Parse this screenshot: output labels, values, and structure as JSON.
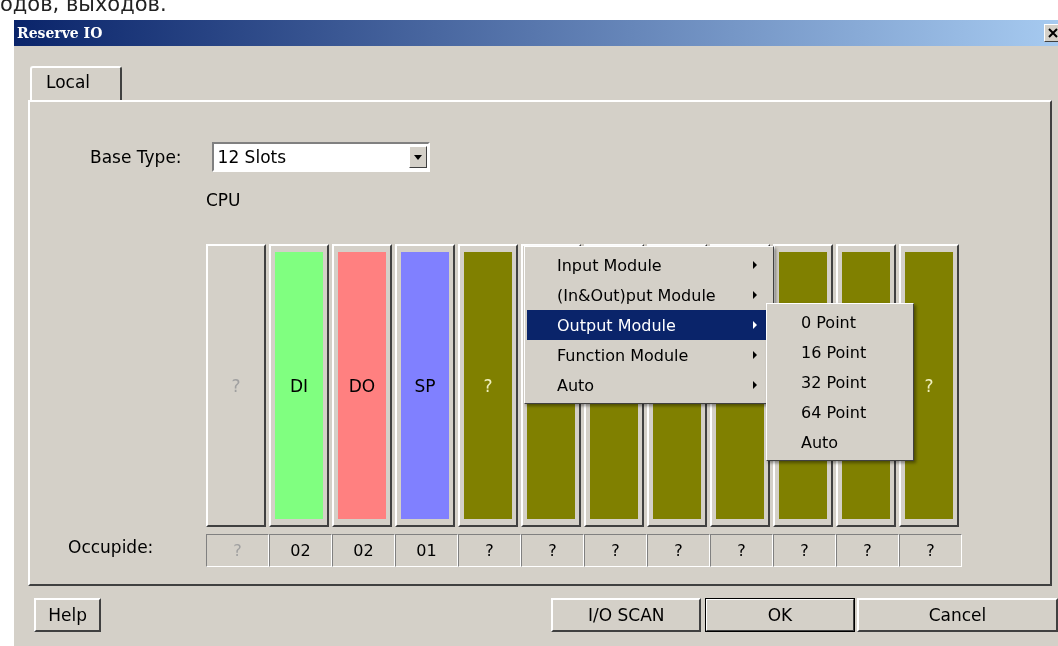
{
  "caption": "одов, выходов.",
  "window": {
    "title": "Reserve IO"
  },
  "tabs": [
    {
      "label": "Local",
      "selected": true
    }
  ],
  "base_type": {
    "label": "Base Type:",
    "value": "12 Slots"
  },
  "cpu_label": "CPU",
  "slots": [
    {
      "kind": "empty",
      "label": "?"
    },
    {
      "kind": "module",
      "label": "DI",
      "color": "#80ff80"
    },
    {
      "kind": "module",
      "label": "DO",
      "color": "#ff8080"
    },
    {
      "kind": "module",
      "label": "SP",
      "color": "#8080ff"
    },
    {
      "kind": "module",
      "label": "?",
      "color": "#808000"
    },
    {
      "kind": "module",
      "color": "#808000"
    },
    {
      "kind": "module",
      "color": "#808000"
    },
    {
      "kind": "module",
      "color": "#808000"
    },
    {
      "kind": "module",
      "color": "#808000"
    },
    {
      "kind": "module",
      "color": "#808000"
    },
    {
      "kind": "module",
      "color": "#808000"
    },
    {
      "kind": "module",
      "label": "?",
      "color": "#808000"
    }
  ],
  "occupied": {
    "label": "Occupide:",
    "cells": [
      {
        "text": "?",
        "disabled": true
      },
      {
        "text": "02",
        "disabled": false
      },
      {
        "text": "02",
        "disabled": false
      },
      {
        "text": "01",
        "disabled": false
      },
      {
        "text": "?",
        "disabled": false
      },
      {
        "text": "?",
        "disabled": false
      },
      {
        "text": "?",
        "disabled": false
      },
      {
        "text": "?",
        "disabled": false
      },
      {
        "text": "?",
        "disabled": false
      },
      {
        "text": "?",
        "disabled": false
      },
      {
        "text": "?",
        "disabled": false
      },
      {
        "text": "?",
        "disabled": false
      }
    ]
  },
  "context_menu": {
    "items": [
      {
        "label": "Input Module",
        "selected": false
      },
      {
        "label": "(In&Out)put Module",
        "selected": false
      },
      {
        "label": "Output Module",
        "selected": true
      },
      {
        "label": "Function Module",
        "selected": false
      },
      {
        "label": "Auto",
        "selected": false
      }
    ],
    "submenu": {
      "items": [
        "0 Point",
        "16 Point",
        "32 Point",
        "64 Point",
        "Auto"
      ]
    }
  },
  "buttons": [
    {
      "kind": "help",
      "label": "Help"
    },
    {
      "kind": "action",
      "label": "I/O SCAN"
    },
    {
      "kind": "default",
      "label": "OK"
    },
    {
      "kind": "action",
      "label": "Cancel"
    }
  ]
}
